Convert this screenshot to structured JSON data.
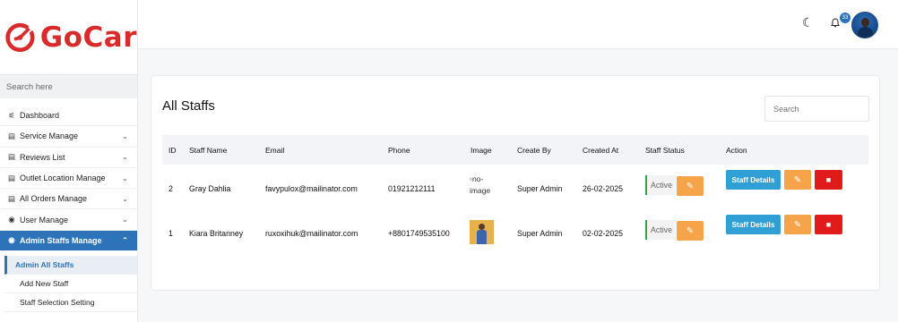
{
  "brand": {
    "name": "GoCar",
    "color": "#d92b2b"
  },
  "sidebar": {
    "search_placeholder": "Search here",
    "items": [
      {
        "label": "Dashboard",
        "icon": "dashboard-icon",
        "glyph": "⚟",
        "chevron": false
      },
      {
        "label": "Service Manage",
        "icon": "table-icon",
        "glyph": "▤",
        "chevron": true
      },
      {
        "label": "Reviews List",
        "icon": "table-icon",
        "glyph": "▤",
        "chevron": true
      },
      {
        "label": "Outlet Location Manage",
        "icon": "table-icon",
        "glyph": "▤",
        "chevron": true
      },
      {
        "label": "All Orders Manage",
        "icon": "table-icon",
        "glyph": "▤",
        "chevron": true
      },
      {
        "label": "User Manage",
        "icon": "user-circle-icon",
        "glyph": "◉",
        "chevron": true
      },
      {
        "label": "Admin Staffs Manage",
        "icon": "user-circle-icon",
        "glyph": "◉",
        "chevron": true,
        "active": true
      }
    ],
    "subitems": [
      {
        "label": "Admin All Staffs",
        "active": true
      },
      {
        "label": "Add New Staff"
      },
      {
        "label": "Staff Selection Setting"
      }
    ]
  },
  "topbar": {
    "notification_count": "33",
    "theme_icon": "moon-icon",
    "bell_icon": "bell-icon"
  },
  "main": {
    "title": "All Staffs",
    "search_placeholder": "Search",
    "columns": [
      "ID",
      "Staff Name",
      "Email",
      "Phone",
      "Image",
      "Create By",
      "Created At",
      "Staff Status",
      "Action"
    ],
    "rows": [
      {
        "id": "2",
        "name": "Gray Dahlia",
        "email": "favypulox@mailinator.com",
        "phone": "01921212111",
        "image_alt": "no-image",
        "created_by": "Super Admin",
        "created_at": "26-02-2025",
        "status": "Active"
      },
      {
        "id": "1",
        "name": "Kiara Britanney",
        "email": "ruxoxihuk@mailinator.com",
        "phone": "+8801749535100",
        "image_alt": "",
        "created_by": "Super Admin",
        "created_at": "02-02-2025",
        "status": "Active"
      }
    ],
    "actions": {
      "details_label": "Staff Details"
    }
  },
  "colors": {
    "primary": "#2c73ba",
    "details_button": "#2f9fd6",
    "edit_button": "#f5a44a",
    "delete_button": "#e11b1b",
    "active_status": "#2fa44f"
  }
}
